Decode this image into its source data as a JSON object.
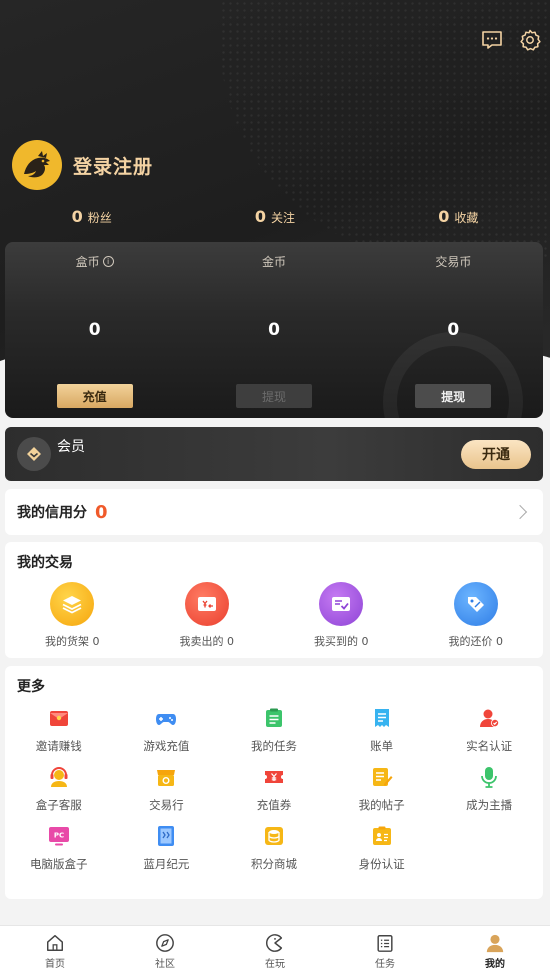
{
  "header": {
    "message_icon": "message-icon",
    "settings_icon": "gear-icon"
  },
  "profile": {
    "avatar_icon": "dragon-logo",
    "login_label": "登录注册"
  },
  "stats": [
    {
      "num": "0",
      "label": "粉丝"
    },
    {
      "num": "0",
      "label": "关注"
    },
    {
      "num": "0",
      "label": "收藏"
    }
  ],
  "wallet": {
    "columns": [
      {
        "label": "盒币",
        "value": "0",
        "button": "充值",
        "has_info": true
      },
      {
        "label": "金币",
        "value": "0",
        "button": "提现",
        "has_info": false
      },
      {
        "label": "交易币",
        "value": "0",
        "button": "提现",
        "has_info": false
      }
    ],
    "info_glyph": "i"
  },
  "member": {
    "label": "会员",
    "button": "开通"
  },
  "credit": {
    "label": "我的信用分",
    "value": "0"
  },
  "trade": {
    "title": "我的交易",
    "items": [
      {
        "label": "我的货架 0",
        "icon": "layers-icon",
        "color": "#f6b716"
      },
      {
        "label": "我卖出的 0",
        "icon": "sold-icon",
        "color": "#f25b4c"
      },
      {
        "label": "我买到的 0",
        "icon": "bought-icon",
        "color": "#a45ce0"
      },
      {
        "label": "我的还价 0",
        "icon": "tag-icon",
        "color": "#3f8df2"
      }
    ]
  },
  "more": {
    "title": "更多",
    "items": [
      {
        "label": "邀请赚钱",
        "icon": "red-envelope-icon"
      },
      {
        "label": "游戏充值",
        "icon": "gamepad-icon"
      },
      {
        "label": "我的任务",
        "icon": "task-icon"
      },
      {
        "label": "账单",
        "icon": "bill-icon"
      },
      {
        "label": "实名认证",
        "icon": "verify-icon"
      },
      {
        "label": "盒子客服",
        "icon": "service-icon"
      },
      {
        "label": "交易行",
        "icon": "shop-icon"
      },
      {
        "label": "充值券",
        "icon": "coupon-icon"
      },
      {
        "label": "我的帖子",
        "icon": "post-icon"
      },
      {
        "label": "成为主播",
        "icon": "microphone-icon"
      },
      {
        "label": "电脑版盒子",
        "icon": "pc-icon",
        "glyph": "PC"
      },
      {
        "label": "蓝月纪元",
        "icon": "book-icon"
      },
      {
        "label": "积分商城",
        "icon": "points-icon"
      },
      {
        "label": "身份认证",
        "icon": "id-card-icon"
      }
    ]
  },
  "tabbar": {
    "items": [
      {
        "label": "首页",
        "icon": "home-icon"
      },
      {
        "label": "社区",
        "icon": "compass-icon"
      },
      {
        "label": "在玩",
        "icon": "pacman-icon"
      },
      {
        "label": "任务",
        "icon": "list-icon"
      },
      {
        "label": "我的",
        "icon": "user-icon",
        "active": true
      }
    ]
  }
}
